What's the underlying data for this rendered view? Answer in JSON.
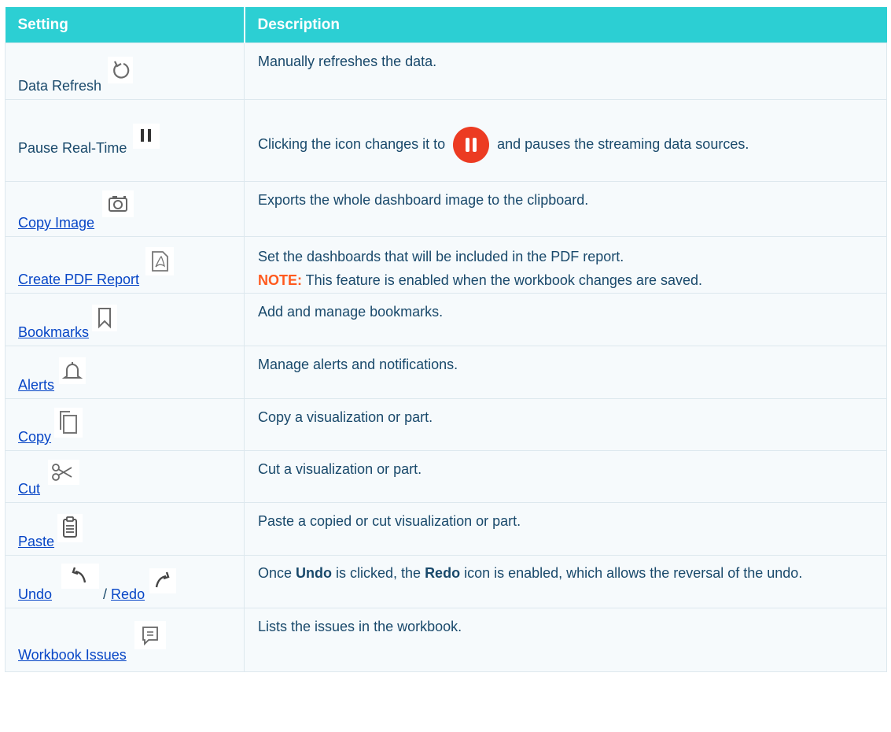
{
  "header": {
    "col_setting": "Setting",
    "col_description": "Description"
  },
  "rows": {
    "r0": {
      "name": "Data Refresh",
      "icon": "refresh-icon",
      "desc": "Manually refreshes the data."
    },
    "r1": {
      "name": "Pause Real-Time",
      "icon": "pause-icon",
      "desc_before": "Clicking the icon changes it to",
      "desc_after": "and pauses the streaming data sources.",
      "inline_icon": "pause-red-icon"
    },
    "r2": {
      "name": "Copy Image",
      "icon": "camera-icon",
      "desc": "Exports the whole dashboard image to the clipboard."
    },
    "r3": {
      "name": "Create PDF Report",
      "icon": "pdf-icon",
      "desc": "Set the dashboards that will be included in the PDF report.",
      "note_label": "NOTE:",
      "note_text": " This feature is enabled when the workbook changes are saved."
    },
    "r4": {
      "name": "Bookmarks",
      "icon": "bookmark-icon",
      "desc": "Add and manage bookmarks."
    },
    "r5": {
      "name": "Alerts",
      "icon": "bell-icon",
      "desc": "Manage alerts and notifications."
    },
    "r6": {
      "name": "Copy",
      "icon": "copy-icon",
      "desc": "Copy a visualization or part."
    },
    "r7": {
      "name": "Cut",
      "icon": "scissors-icon",
      "desc": "Cut a visualization or part."
    },
    "r8": {
      "name": "Paste",
      "icon": "clipboard-icon",
      "desc": "Paste a copied or cut visualization or part."
    },
    "r9": {
      "name_undo": "Undo",
      "separator": " / ",
      "name_redo": "Redo",
      "icons": [
        "undo-icon",
        "redo-icon"
      ],
      "desc_1": "Once ",
      "desc_undo": "Undo",
      "desc_2": " is clicked, the ",
      "desc_redo": "Redo",
      "desc_3": " icon is enabled, which allows the reversal of the undo."
    },
    "r10": {
      "name": "Workbook Issues",
      "icon": "comment-icon",
      "desc": "Lists the issues in the workbook."
    }
  },
  "colors": {
    "header_bg": "#2ccfd3",
    "row_bg": "#f6fafc",
    "link": "#0645c6",
    "text": "#19496b",
    "note": "#ff5a1e",
    "pause_red": "#ec3b22"
  }
}
